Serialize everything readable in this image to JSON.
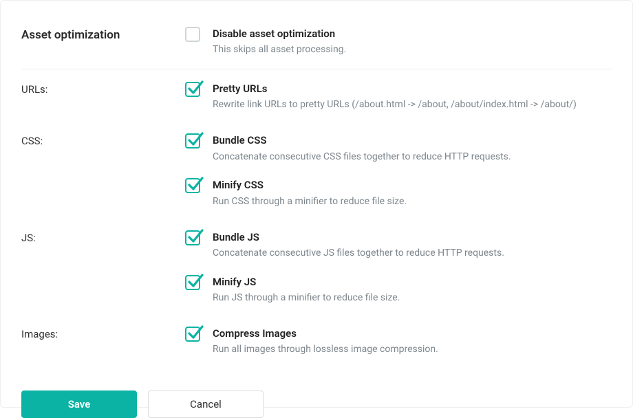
{
  "section_title": "Asset optimization",
  "disable": {
    "title": "Disable asset optimization",
    "desc": "This skips all asset processing.",
    "checked": false
  },
  "groups": [
    {
      "label": "URLs:",
      "options": [
        {
          "title": "Pretty URLs",
          "desc": "Rewrite link URLs to pretty URLs (/about.html -> /about, /about/index.html -> /about/)",
          "checked": true
        }
      ]
    },
    {
      "label": "CSS:",
      "options": [
        {
          "title": "Bundle CSS",
          "desc": "Concatenate consecutive CSS files together to reduce HTTP requests.",
          "checked": true
        },
        {
          "title": "Minify CSS",
          "desc": "Run CSS through a minifier to reduce file size.",
          "checked": true
        }
      ]
    },
    {
      "label": "JS:",
      "options": [
        {
          "title": "Bundle JS",
          "desc": "Concatenate consecutive JS files together to reduce HTTP requests.",
          "checked": true
        },
        {
          "title": "Minify JS",
          "desc": "Run JS through a minifier to reduce file size.",
          "checked": true
        }
      ]
    },
    {
      "label": "Images:",
      "options": [
        {
          "title": "Compress Images",
          "desc": "Run all images through lossless image compression.",
          "checked": true
        }
      ]
    }
  ],
  "actions": {
    "save": "Save",
    "cancel": "Cancel"
  }
}
